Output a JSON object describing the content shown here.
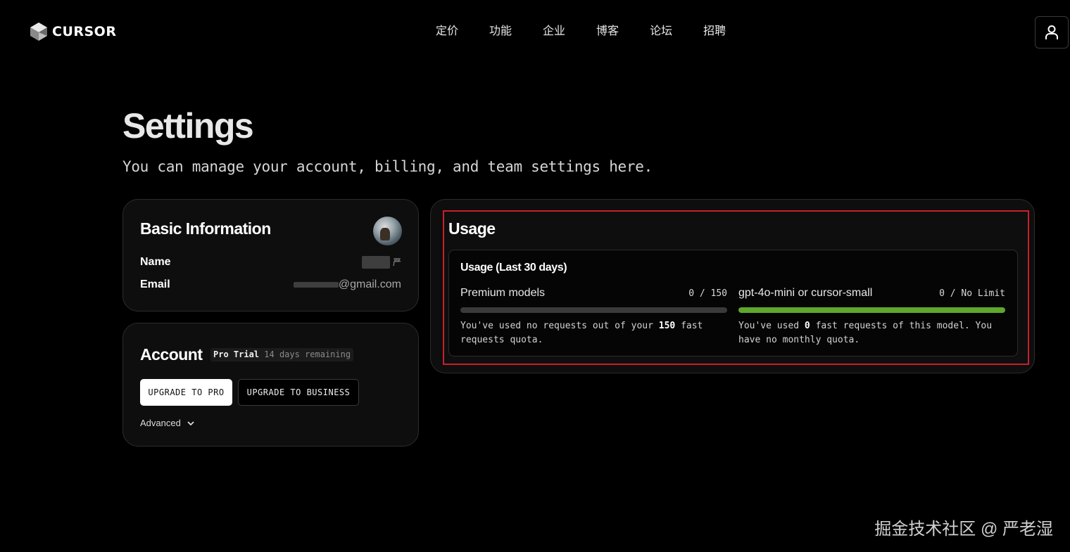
{
  "header": {
    "logo_text": "CURSOR",
    "nav": [
      "定价",
      "功能",
      "企业",
      "博客",
      "论坛",
      "招聘"
    ],
    "user_icon": "user-icon"
  },
  "page": {
    "title": "Settings",
    "subtitle": "You can manage your account, billing, and team settings here."
  },
  "basic_info": {
    "title": "Basic Information",
    "name_label": "Name",
    "name_value": "严",
    "email_label": "Email",
    "email_value": "@gmail.com"
  },
  "account": {
    "title": "Account",
    "plan": "Pro Trial",
    "remaining": "14 days remaining",
    "upgrade_pro": "UPGRADE TO PRO",
    "upgrade_business": "UPGRADE TO BUSINESS",
    "advanced": "Advanced"
  },
  "usage": {
    "title": "Usage",
    "subtitle": "Usage (Last 30 days)",
    "premium": {
      "name": "Premium models",
      "count": "0 / 150",
      "used_fraction": 0,
      "desc_pre": "You've used no requests out of your ",
      "desc_bold": "150",
      "desc_post": " fast requests quota."
    },
    "small": {
      "name": "gpt-4o-mini or cursor-small",
      "count": "0 / No Limit",
      "used_fraction": 1,
      "desc_pre": "You've used ",
      "desc_bold": "0",
      "desc_post": " fast requests of this model. You have no monthly quota."
    }
  },
  "colors": {
    "accent_green": "#5ea82d",
    "highlight_red": "#c8202b"
  },
  "watermark": "掘金技术社区 @ 严老湿"
}
